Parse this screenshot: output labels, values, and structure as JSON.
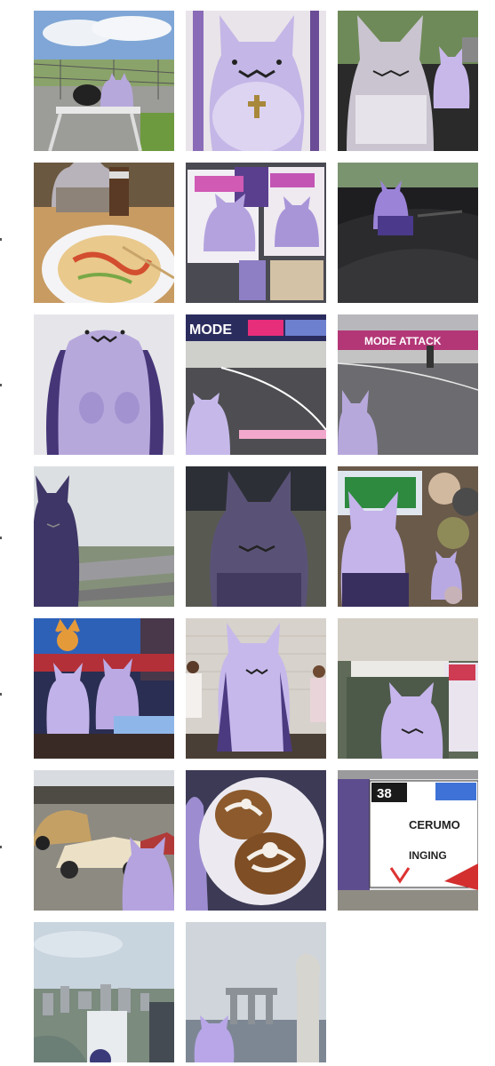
{
  "photos": [
    {
      "subject": "purple plush on tripod at racetrack fence"
    },
    {
      "subject": "purple plush with cross necklace close-up"
    },
    {
      "subject": "purple plush in car with small plush"
    },
    {
      "subject": "plush beside noodle bowl and drink"
    },
    {
      "subject": "anime merchandise cards with plush"
    },
    {
      "subject": "small plush on car dashboard"
    },
    {
      "subject": "purple plush front view"
    },
    {
      "subject": "plush at racetrack with MODE banner",
      "banner_text": "MODE"
    },
    {
      "subject": "plush at racetrack with ATTACK banner",
      "banner_text": "MODE ATTACK"
    },
    {
      "subject": "dark plush overlooking racetrack"
    },
    {
      "subject": "dark plush close-up outdoors"
    },
    {
      "subject": "plush with other plushies near monitor"
    },
    {
      "subject": "two plushies and cat figure"
    },
    {
      "subject": "plush between two figures"
    },
    {
      "subject": "plush at store entrance"
    },
    {
      "subject": "plush with classic cars"
    },
    {
      "subject": "plush with pastries on plate"
    },
    {
      "subject": "plush with racing sponsor board",
      "sponsor_number": "38",
      "sponsor_texts": [
        "CERUMO",
        "INGING"
      ]
    },
    {
      "subject": "city skyline view from above"
    },
    {
      "subject": "plush with Marina Bay Sands and Merlion"
    }
  ],
  "colors": {
    "plush_lavender": "#b7a8dc",
    "plush_dark": "#3e3666",
    "background": "#ffffff"
  }
}
